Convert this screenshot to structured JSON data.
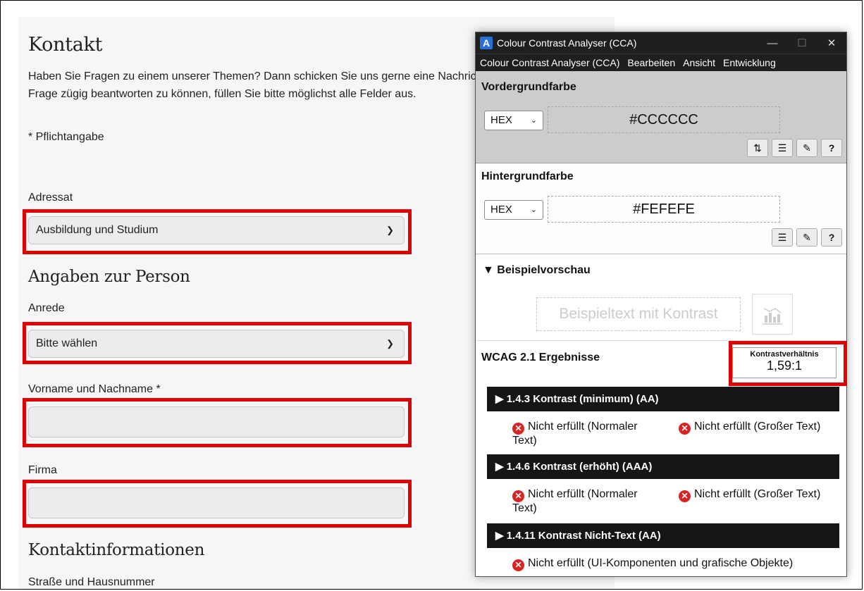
{
  "form": {
    "title": "Kontakt",
    "intro_line1": "Haben Sie Fragen zu einem unserer Themen? Dann schicken Sie uns gerne eine Nachricht. Um Ihre",
    "intro_line2": "Frage zügig beantworten zu können, füllen Sie bitte möglichst alle Felder aus.",
    "required_note": "* Pflichtangabe",
    "adressat_label": "Adressat",
    "adressat_value": "Ausbildung und Studium",
    "person_heading": "Angaben zur Person",
    "anrede_label": "Anrede",
    "anrede_value": "Bitte wählen",
    "name_label": "Vorname und Nachname *",
    "firma_label": "Firma",
    "contact_heading": "Kontaktinformationen",
    "street_label": "Straße und Hausnummer"
  },
  "cca": {
    "window_title": "Colour Contrast Analyser (CCA)",
    "menu": [
      "Colour Contrast Analyser (CCA)",
      "Bearbeiten",
      "Ansicht",
      "Entwicklung"
    ],
    "foreground": {
      "title": "Vordergrundfarbe",
      "format": "HEX",
      "value": "#CCCCCC",
      "color": "#cccccc"
    },
    "background": {
      "title": "Hintergrundfarbe",
      "format": "HEX",
      "value": "#FEFEFE",
      "color": "#fefefe"
    },
    "preview": {
      "title": "▼ Beispielvorschau",
      "sample_text": "Beispieltext mit Kontrast"
    },
    "results": {
      "title": "WCAG 2.1 Ergebnisse",
      "ratio_label": "Kontrastverhältnis",
      "ratio_value": "1,59:1",
      "criteria": [
        {
          "label": "▶ 1.4.3 Kontrast (minimum) (AA)",
          "result_normal": "Nicht erfüllt (Normaler Text)",
          "result_large": "Nicht erfüllt (Großer Text)"
        },
        {
          "label": "▶ 1.4.6 Kontrast (erhöht) (AAA)",
          "result_normal": "Nicht erfüllt (Normaler Text)",
          "result_large": "Nicht erfüllt (Großer Text)"
        },
        {
          "label": "▶ 1.4.11 Kontrast Nicht-Text (AA)",
          "result_ui": "Nicht erfüllt (UI-Komponenten und grafische Objekte)"
        }
      ]
    }
  },
  "colors": {
    "highlight": "#e00000",
    "fail": "#dd2222",
    "titlebar": "#1f1f1f"
  }
}
